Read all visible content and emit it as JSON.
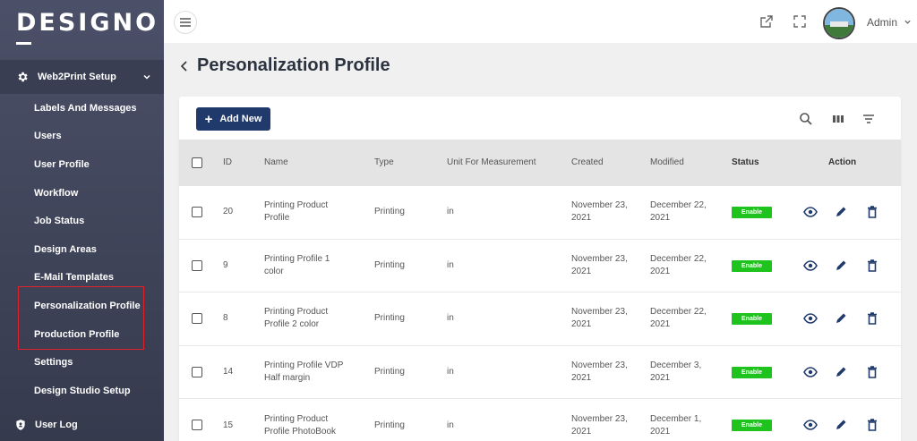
{
  "app": {
    "logo": "DESIGNO"
  },
  "sidebar": {
    "section_label": "Web2Print Setup",
    "items": [
      {
        "label": "Labels And Messages"
      },
      {
        "label": "Users"
      },
      {
        "label": "User Profile"
      },
      {
        "label": "Workflow"
      },
      {
        "label": "Job Status"
      },
      {
        "label": "Design Areas"
      },
      {
        "label": "E-Mail Templates"
      },
      {
        "label": "Personalization Profile"
      },
      {
        "label": "Production Profile"
      },
      {
        "label": "Settings"
      },
      {
        "label": "Design Studio Setup"
      }
    ],
    "user_log": "User Log"
  },
  "topbar": {
    "user_name": "Admin"
  },
  "page": {
    "title": "Personalization Profile"
  },
  "toolbar": {
    "add_new": "Add New"
  },
  "table": {
    "headers": {
      "id": "ID",
      "name": "Name",
      "type": "Type",
      "unit": "Unit For Measurement",
      "created": "Created",
      "modified": "Modified",
      "status": "Status",
      "action": "Action"
    },
    "rows": [
      {
        "id": "20",
        "name_1": "Printing Product",
        "name_2": "Profile",
        "type": "Printing",
        "unit": "in",
        "created_1": "November 23,",
        "created_2": "2021",
        "modified_1": "December 22,",
        "modified_2": "2021",
        "status": "Enable"
      },
      {
        "id": "9",
        "name_1": "Printing Profile 1",
        "name_2": "color",
        "type": "Printing",
        "unit": "in",
        "created_1": "November 23,",
        "created_2": "2021",
        "modified_1": "December 22,",
        "modified_2": "2021",
        "status": "Enable"
      },
      {
        "id": "8",
        "name_1": "Printing Product",
        "name_2": "Profile 2 color",
        "type": "Printing",
        "unit": "in",
        "created_1": "November 23,",
        "created_2": "2021",
        "modified_1": "December 22,",
        "modified_2": "2021",
        "status": "Enable"
      },
      {
        "id": "14",
        "name_1": "Printing Profile VDP",
        "name_2": "Half margin",
        "type": "Printing",
        "unit": "in",
        "created_1": "November 23,",
        "created_2": "2021",
        "modified_1": "December 3,",
        "modified_2": "2021",
        "status": "Enable"
      },
      {
        "id": "15",
        "name_1": "Printing Product",
        "name_2": "Profile PhotoBook",
        "type": "Printing",
        "unit": "in",
        "created_1": "November 23,",
        "created_2": "2021",
        "modified_1": "December 1,",
        "modified_2": "2021",
        "status": "Enable"
      }
    ]
  },
  "colors": {
    "sidebar_bg": "#4b5068",
    "primary_button": "#1f3a6b",
    "status_enable": "#1ec31e",
    "highlight": "#e0202a"
  },
  "icons": [
    "gear-icon",
    "chevron-down-icon",
    "shield-icon",
    "menu-icon",
    "external-link-icon",
    "fullscreen-icon",
    "search-icon",
    "columns-icon",
    "filter-icon",
    "eye-icon",
    "edit-icon",
    "delete-icon",
    "back-chevron-icon"
  ]
}
